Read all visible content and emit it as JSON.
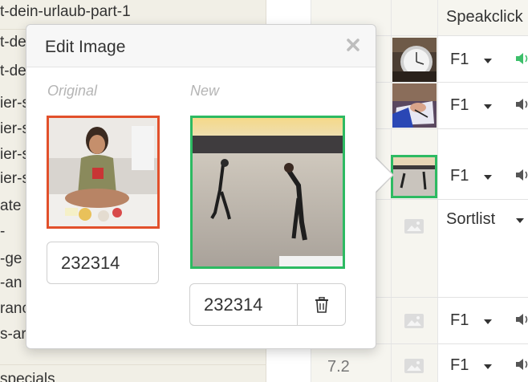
{
  "background": {
    "left_rows": [
      "t-dein-urlaub-part-1",
      "t-de",
      "t-de",
      "ier-s",
      "ier-s",
      "ier-s",
      "ier-s",
      "ate",
      "-",
      "-ge",
      "-an",
      "ranc",
      "s-ar",
      "specials"
    ],
    "header_select": "Speakclick",
    "rows": [
      {
        "select": "F1",
        "speaker": "speaker-green-icon"
      },
      {
        "select": "F1",
        "speaker": "speaker-icon"
      },
      {
        "select": "F1",
        "speaker": "speaker-icon"
      },
      {
        "select": "Sortlist",
        "speaker": ""
      },
      {
        "select": "F1",
        "speaker": "speaker-icon"
      },
      {
        "select": "F1",
        "speaker": "speaker-icon",
        "number": "7.2"
      }
    ],
    "colors": {
      "left_bg": "#f1efe6",
      "cell_bg": "#f6f5ef",
      "speaker_green": "#3cbf6a",
      "selected_border": "#2dba62"
    }
  },
  "popover": {
    "title": "Edit Image",
    "close_icon": "close-icon",
    "original": {
      "label": "Original",
      "id_value": "232314",
      "border_color": "#e2502b"
    },
    "new": {
      "label": "New",
      "id_value": "232314",
      "border_color": "#2dba62",
      "delete_icon": "trash-icon"
    }
  }
}
